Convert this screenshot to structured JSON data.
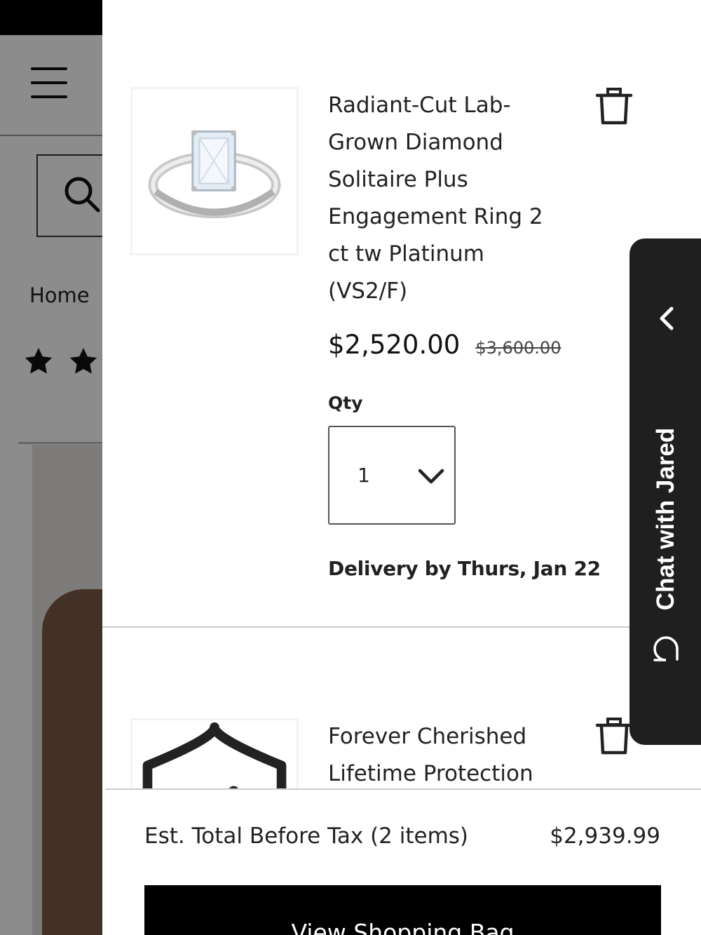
{
  "background_page": {
    "breadcrumb_home": "Home",
    "breadcrumb_sep": "/"
  },
  "cart": {
    "items": [
      {
        "title": "Radiant-Cut Lab-Grown Diamond Solitaire Plus Engagement Ring 2 ct tw Platinum (VS2/F)",
        "price": "$2,520.00",
        "original_price": "$3,600.00",
        "qty_label": "Qty",
        "qty_value": "1",
        "delivery": "Delivery by Thurs, Jan 22",
        "image_icon": "ring-image"
      },
      {
        "title": "Forever Cherished Lifetime Protection",
        "image_icon": "shield-icon"
      }
    ],
    "footer": {
      "total_label": "Est. Total Before Tax (2 items)",
      "total_value": "$2,939.99",
      "button_label": "View Shopping Bag"
    }
  },
  "chat": {
    "label": "Chat with Jared",
    "expand_icon": "chevron-left-icon",
    "bubble_icon": "chat-bubble-icon"
  },
  "colors": {
    "drawer_bg": "#ffffff",
    "chat_tab_bg": "#1f1f1f",
    "button_bg": "#000000",
    "overlay": "rgba(0,0,0,0.45)"
  }
}
